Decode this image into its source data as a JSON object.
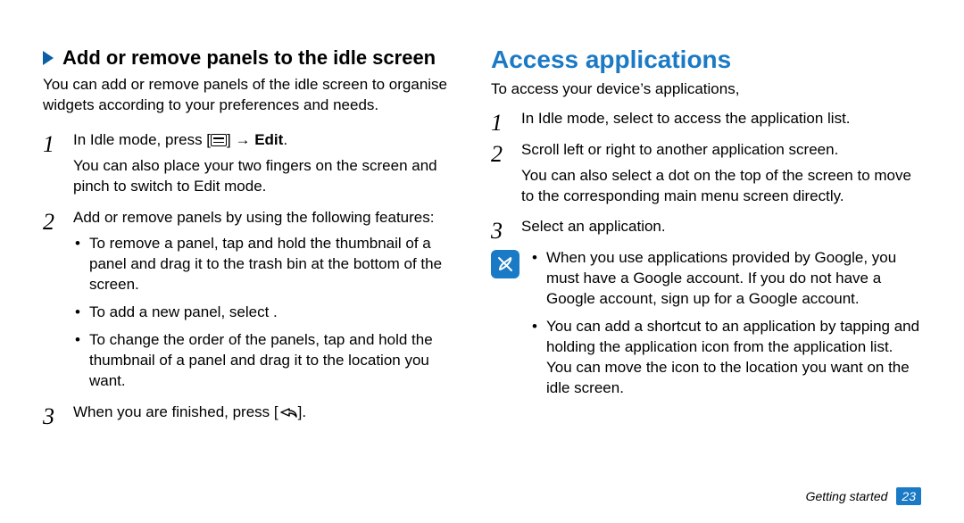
{
  "left": {
    "heading": "Add or remove panels to the idle screen",
    "intro": "You can add or remove panels of the idle screen to organise widgets according to your preferences and needs.",
    "step1_a": "In Idle mode, press [",
    "step1_b": "] → ",
    "step1_edit": "Edit",
    "step1_c": ".",
    "step1_extra": "You can also place your two fingers on the screen and pinch to switch to Edit mode.",
    "step2": "Add or remove panels by using the following features:",
    "step2_b1": "To remove a panel, tap and hold the thumbnail of a panel and drag it to the trash bin at the bottom of the screen.",
    "step2_b2": "To add a new panel, select       .",
    "step2_b3": "To change the order of the panels, tap and hold the thumbnail of a panel and drag it to the location you want.",
    "step3_a": "When you are finished, press [",
    "step3_b": "].",
    "n1": "1",
    "n2": "2",
    "n3": "3"
  },
  "right": {
    "title": "Access applications",
    "intro": "To access your device’s applications,",
    "step1": "In Idle mode, select        to access the application list.",
    "step2": "Scroll left or right to another application screen.",
    "step2_extra": "You can also select a dot on the top of the screen to move to the corresponding main menu screen directly.",
    "step3": "Select an application.",
    "note_b1": "When you use applications provided by Google, you must have a Google account. If you do not have a Google account, sign up for a Google account.",
    "note_b2": "You can add a shortcut to an application by tapping and holding the application icon from the application list. You can move the icon to the location you want on the idle screen.",
    "n1": "1",
    "n2": "2",
    "n3": "3"
  },
  "footer": {
    "section": "Getting started",
    "page": "23"
  }
}
